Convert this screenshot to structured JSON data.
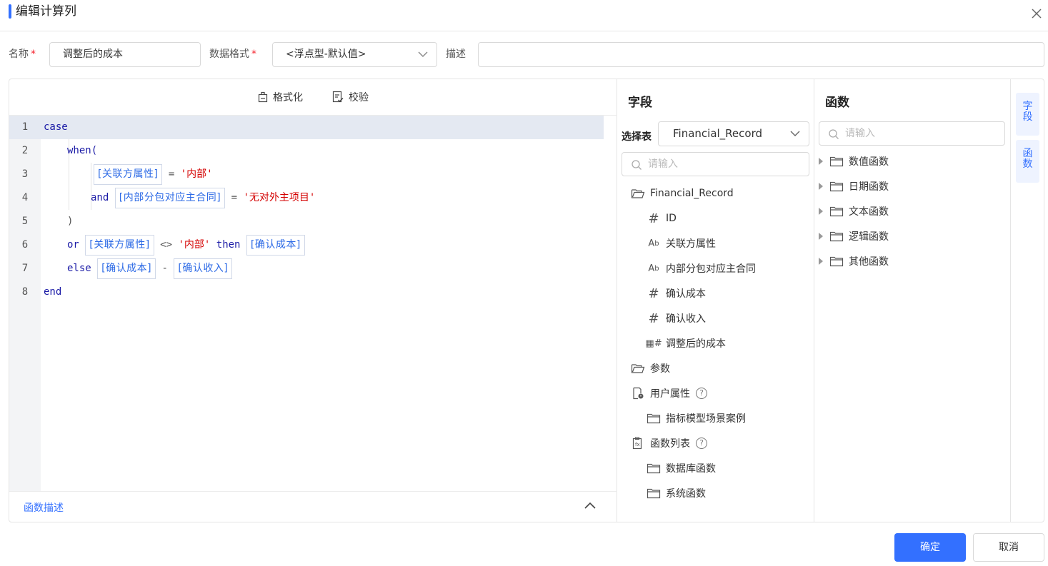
{
  "dialog": {
    "title": "编辑计算列"
  },
  "form": {
    "name_label": "名称",
    "name_value": "调整后的成本",
    "format_label": "数据格式",
    "format_value": "<浮点型-默认值>",
    "desc_label": "描述",
    "desc_value": "",
    "required_mark": "*"
  },
  "toolbar": {
    "format_label": "格式化",
    "validate_label": "校验"
  },
  "editor": {
    "line_numbers": [
      "1",
      "2",
      "3",
      "4",
      "5",
      "6",
      "7",
      "8"
    ],
    "tokens": {
      "case": "case",
      "when": "when(",
      "fld_relation": "[关联方属性]",
      "eq": "=",
      "str_internal": "'内部'",
      "and": "and",
      "fld_contract": "[内部分包对应主合同]",
      "str_no_main": "'无对外主项目'",
      "close_paren": ")",
      "or": "or",
      "neq": "<>",
      "then": "then",
      "fld_cost": "[确认成本]",
      "else": "else",
      "minus": "-",
      "fld_income": "[确认收入]",
      "end": "end"
    }
  },
  "function_desc": {
    "label": "函数描述"
  },
  "fields_panel": {
    "title": "字段",
    "select_table_label": "选择表",
    "select_table_value": "Financial_Record",
    "search_placeholder": "请输入",
    "root": "Financial_Record",
    "columns": [
      {
        "icon": "#",
        "label": "ID"
      },
      {
        "icon": "Ab",
        "label": "关联方属性"
      },
      {
        "icon": "Ab",
        "label": "内部分包对应主合同"
      },
      {
        "icon": "#",
        "label": "确认成本"
      },
      {
        "icon": "#",
        "label": "确认收入"
      },
      {
        "icon": "calc#",
        "label": "调整后的成本"
      }
    ],
    "params": "参数",
    "user_attrs": "用户属性",
    "user_attr_child": "指标模型场景案例",
    "func_list": "函数列表",
    "func_list_children": [
      "数据库函数",
      "系统函数"
    ],
    "help_mark": "?"
  },
  "functions_panel": {
    "title": "函数",
    "search_placeholder": "请输入",
    "groups": [
      "数值函数",
      "日期函数",
      "文本函数",
      "逻辑函数",
      "其他函数"
    ]
  },
  "side_tabs": {
    "fields": "字段",
    "functions": "函数"
  },
  "footer": {
    "ok": "确定",
    "cancel": "取消"
  }
}
